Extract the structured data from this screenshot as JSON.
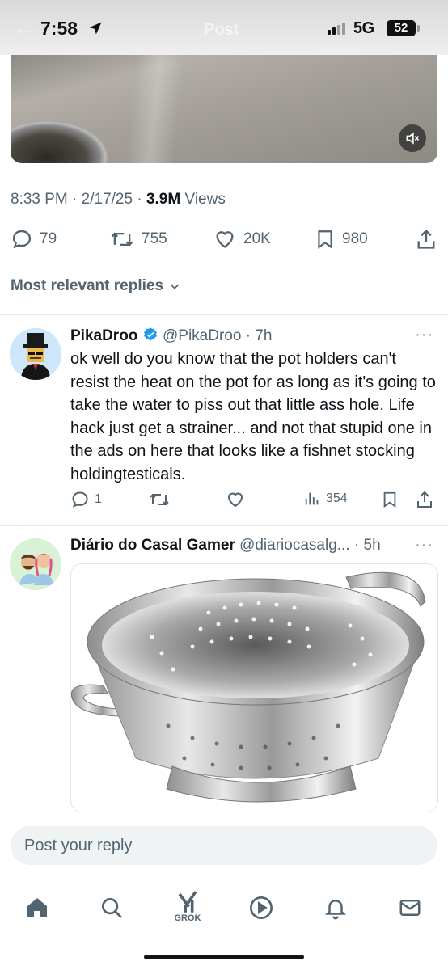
{
  "status_bar": {
    "time": "7:58",
    "network": "5G",
    "battery_percent": "52",
    "battery_level": 0.52,
    "ghost_title": "Post"
  },
  "post": {
    "time": "8:33 PM",
    "date": "2/17/25",
    "views_count": "3.9M",
    "views_label": "Views",
    "stats": {
      "replies": "79",
      "reposts": "755",
      "likes": "20K",
      "bookmarks": "980"
    }
  },
  "sort": {
    "label": "Most relevant replies"
  },
  "replies": [
    {
      "name": "PikaDroo",
      "handle": "@PikaDroo",
      "time": "7h",
      "verified": true,
      "text": "ok well do you know that the pot holders can't resist the heat on the pot for as long as it's going to take the water to piss out that little ass hole. Life hack just get a strainer... and not that stupid one in the ads on here that looks like a fishnet stocking holdingtesticals.",
      "stats": {
        "replies": "1",
        "views": "354"
      }
    },
    {
      "name": "Diário do Casal Gamer",
      "handle": "@diariocasalg...",
      "time": "5h"
    }
  ],
  "compose": {
    "placeholder": "Post your reply"
  },
  "tabbar": {
    "grok_label": "GROK"
  },
  "colors": {
    "text_primary": "#0f1419",
    "text_secondary": "#536471",
    "verified_blue": "#1d9bf0",
    "input_bg": "#eff3f4"
  },
  "icons": [
    "location-arrow-icon",
    "mute-icon",
    "reply-icon",
    "repost-icon",
    "like-icon",
    "bookmark-icon",
    "share-icon",
    "chevron-down-icon",
    "verified-badge-icon",
    "more-icon",
    "views-icon",
    "home-icon",
    "search-icon",
    "grok-icon",
    "video-icon",
    "notifications-icon",
    "messages-icon"
  ]
}
